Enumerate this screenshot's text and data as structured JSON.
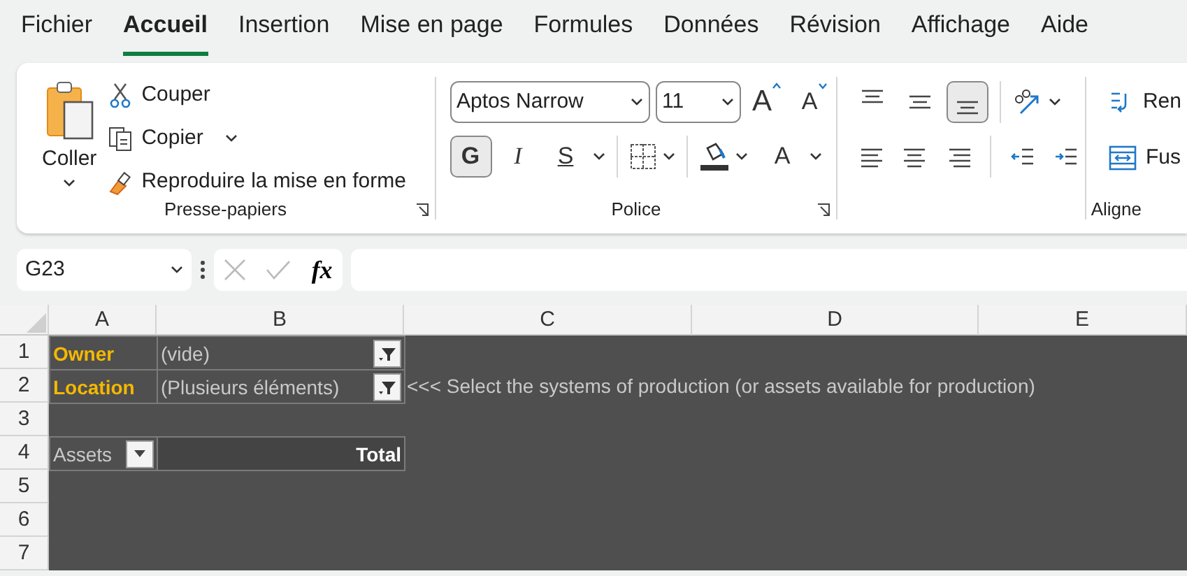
{
  "menu_tabs": [
    {
      "label": "Fichier",
      "selected": false
    },
    {
      "label": "Accueil",
      "selected": true
    },
    {
      "label": "Insertion",
      "selected": false
    },
    {
      "label": "Mise en page",
      "selected": false
    },
    {
      "label": "Formules",
      "selected": false
    },
    {
      "label": "Données",
      "selected": false
    },
    {
      "label": "Révision",
      "selected": false
    },
    {
      "label": "Affichage",
      "selected": false
    },
    {
      "label": "Aide",
      "selected": false
    }
  ],
  "ribbon": {
    "clipboard": {
      "paste": "Coller",
      "actions": [
        {
          "label": "Couper",
          "kind": "cut"
        },
        {
          "label": "Copier",
          "kind": "copy"
        },
        {
          "label": "Reproduire la mise en forme",
          "kind": "painter"
        }
      ],
      "label": "Presse-papiers"
    },
    "font": {
      "font_name": "Aptos Narrow",
      "font_size": "11",
      "size_buttons": [
        {
          "kind": "grow",
          "label": "A"
        },
        {
          "kind": "shrink",
          "label": "A"
        }
      ],
      "styles": [
        {
          "kind": "bold",
          "label": "G",
          "selected": true
        },
        {
          "kind": "italic",
          "label": "I",
          "selected": false
        },
        {
          "kind": "underline",
          "label": "S",
          "selected": false
        }
      ],
      "font_color": "A",
      "label": "Police"
    },
    "alignment": {
      "vertical": [
        {
          "kind": "top",
          "selected": false
        },
        {
          "kind": "middle",
          "selected": false
        },
        {
          "kind": "bottom",
          "selected": true
        }
      ],
      "horizontal": [
        {
          "kind": "left",
          "selected": false
        },
        {
          "kind": "center",
          "selected": false
        },
        {
          "kind": "right",
          "selected": false
        }
      ],
      "label": "Aligne"
    },
    "next_group": {
      "items": [
        {
          "label": "Ren",
          "kind": "wrap"
        },
        {
          "label": "Fus",
          "kind": "merge"
        }
      ]
    }
  },
  "formula_bar": {
    "name_box": "G23",
    "function_label": "fx"
  },
  "sheet": {
    "columns": [
      "A",
      "B",
      "C",
      "D",
      "E"
    ],
    "rows": [
      {
        "number": "1",
        "cells": [
          {
            "kind": "label",
            "text": "Owner"
          },
          {
            "kind": "filter",
            "text": "(vide)"
          }
        ]
      },
      {
        "number": "2",
        "cells": [
          {
            "kind": "label",
            "text": "Location"
          },
          {
            "kind": "filter",
            "text": "(Plusieurs éléments)"
          },
          {
            "kind": "note",
            "text": "<<< Select the systems of production (or assets available for production)"
          }
        ]
      },
      {
        "number": "3"
      },
      {
        "number": "4",
        "cells": [
          {
            "kind": "dropdown",
            "text": "Assets"
          },
          {
            "kind": "total",
            "text": "Total"
          }
        ]
      },
      {
        "number": "5"
      },
      {
        "number": "6"
      },
      {
        "number": "7"
      }
    ]
  }
}
